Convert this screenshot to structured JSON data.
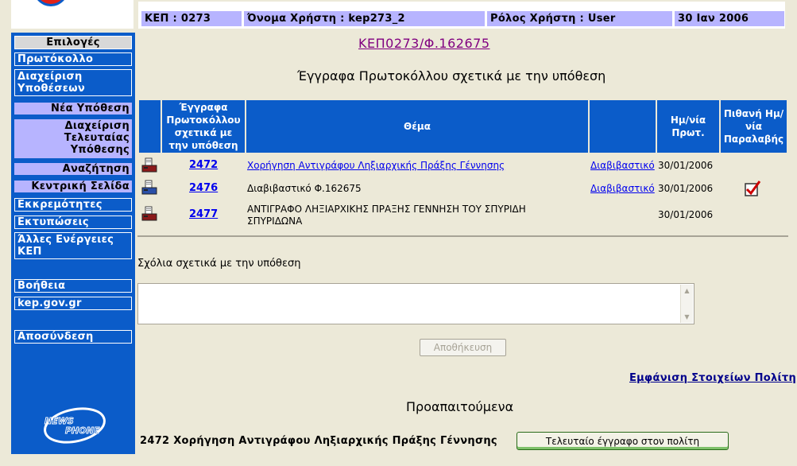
{
  "header": {
    "kep": "ΚΕΠ : 0273",
    "user": "Όνομα Χρήστη : kep273_2",
    "role": "Ρόλος Χρήστη : User",
    "date": "30 Ιαν 2006"
  },
  "sidebar": {
    "title": "Επιλογές",
    "protocol": "Πρωτόκολλο",
    "manage_cases": "Διαχείριση Υποθέσεων",
    "new_case": "Νέα Υπόθεση",
    "manage_last_case": "Διαχείριση Τελευταίας Υπόθεσης",
    "search": "Αναζήτηση",
    "home": "Κεντρική Σελίδα",
    "pending": "Εκκρεμότητες",
    "prints": "Εκτυπώσεις",
    "other_actions": "Άλλες Ενέργειες ΚΕΠ",
    "help": "Βοήθεια",
    "site": "kep.gov.gr",
    "logout": "Αποσύνδεση",
    "brand_logo_text": "NEWSPHONE"
  },
  "page": {
    "case_link": "ΚΕΠ0273/Φ.162675",
    "heading": "Έγγραφα Πρωτοκόλλου σχετικά με την υπόθεση"
  },
  "table": {
    "columns": {
      "docs": "Έγγραφα Πρωτοκόλλου σχετικά με την υπόθεση",
      "subject": "Θέμα",
      "date": "Ημ/νία Πρωτ.",
      "receipt": "Πιθανή Ημ/νία Παραλαβής"
    },
    "rows": [
      {
        "num": "2472",
        "subject": "Χορήγηση Αντιγράφου Ληξιαρχικής Πράξης Γέννησης",
        "type": "Διαβιβαστικό",
        "date": "30/01/2006",
        "checked": false
      },
      {
        "num": "2476",
        "subject": "Διαβιβαστικό Φ.162675",
        "type": "Διαβιβαστικό",
        "date": "30/01/2006",
        "checked": true
      },
      {
        "num": "2477",
        "subject": "ΑΝΤΙΓΡΑΦΟ ΛΗΞΙΑΡΧΙΚΗΣ ΠΡΑΞΗΣ ΓΕΝΝΗΣΗ ΤΟΥ ΣΠΥΡΙΔΗ ΣΠΥΡΙΔΩΝΑ",
        "type": "",
        "date": "30/01/2006",
        "checked": false
      }
    ]
  },
  "comments": {
    "label": "Σχόλια σχετικά με την υπόθεση",
    "value": ""
  },
  "buttons": {
    "save": "Αποθήκευση",
    "last_doc": "Τελευταίο έγγραφο στον πολίτη"
  },
  "citizen_link": "Εμφάνιση Στοιχείων Πολίτη",
  "prereq": {
    "title": "Προαπαιτούμενα",
    "item": "2472  Χορήγηση Αντιγράφου Ληξιαρχικής Πράξης Γέννησης"
  },
  "colors": {
    "sidebar_blue": "#0b5cc9",
    "header_lavender": "#b7b4ff",
    "page_bg": "#ece9d8"
  }
}
